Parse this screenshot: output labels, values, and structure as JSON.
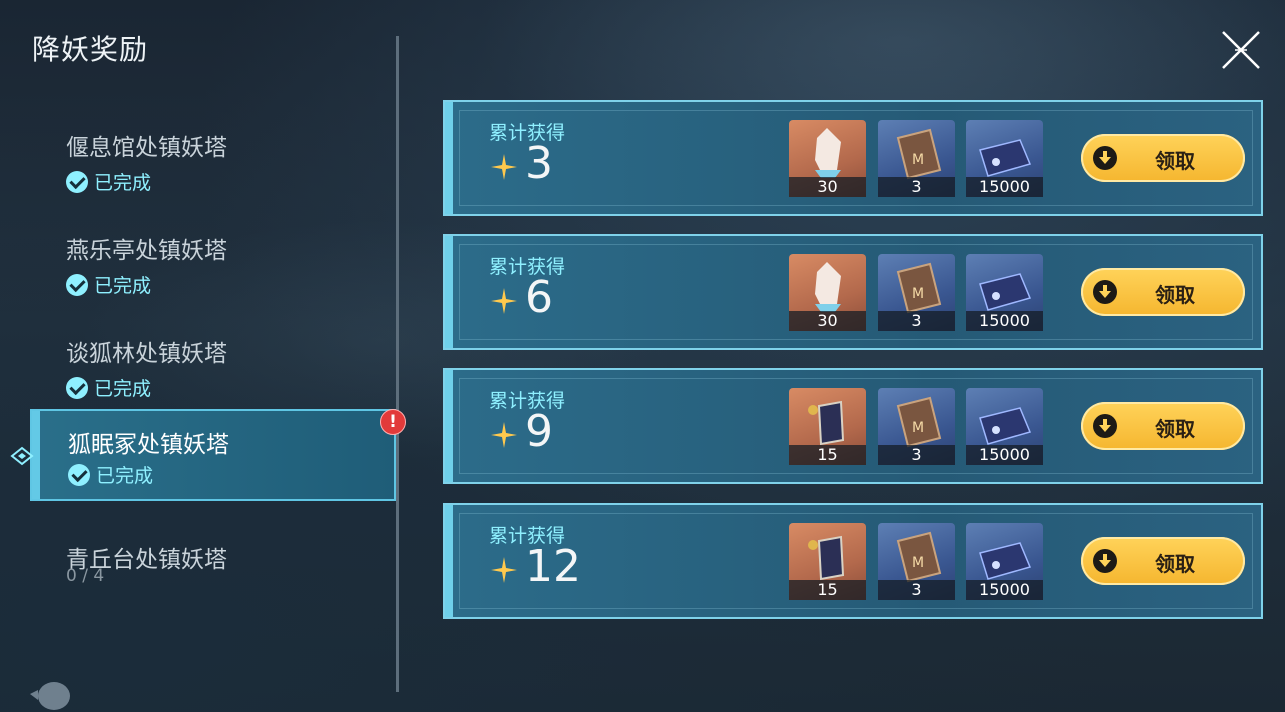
{
  "title": "降妖奖励",
  "sidebar": {
    "items": [
      {
        "name": "偃息馆处镇妖塔",
        "status": "已完成"
      },
      {
        "name": "燕乐亭处镇妖塔",
        "status": "已完成"
      },
      {
        "name": "谈狐林处镇妖塔",
        "status": "已完成"
      },
      {
        "name": "狐眠冢处镇妖塔",
        "status": "已完成",
        "alert": "!"
      },
      {
        "name": "青丘台处镇妖塔",
        "status": "0 / 4"
      }
    ]
  },
  "rewards": [
    {
      "label": "累计获得",
      "count": "3",
      "items": [
        {
          "icon": "crystal-icon",
          "qty": "30"
        },
        {
          "icon": "book-icon",
          "qty": "3"
        },
        {
          "icon": "ticket-icon",
          "qty": "15000"
        }
      ],
      "button": "领取"
    },
    {
      "label": "累计获得",
      "count": "6",
      "items": [
        {
          "icon": "crystal-icon",
          "qty": "30"
        },
        {
          "icon": "book-icon",
          "qty": "3"
        },
        {
          "icon": "ticket-icon",
          "qty": "15000"
        }
      ],
      "button": "领取"
    },
    {
      "label": "累计获得",
      "count": "9",
      "items": [
        {
          "icon": "card-pack-icon",
          "qty": "15"
        },
        {
          "icon": "book-icon",
          "qty": "3"
        },
        {
          "icon": "ticket-icon",
          "qty": "15000"
        }
      ],
      "button": "领取"
    },
    {
      "label": "累计获得",
      "count": "12",
      "items": [
        {
          "icon": "card-pack-icon",
          "qty": "15"
        },
        {
          "icon": "book-icon",
          "qty": "3"
        },
        {
          "icon": "ticket-icon",
          "qty": "15000"
        }
      ],
      "button": "领取"
    }
  ],
  "colors": {
    "accent": "#8ff0ff",
    "button": "#f5b62f",
    "alert": "#e23a3a"
  }
}
